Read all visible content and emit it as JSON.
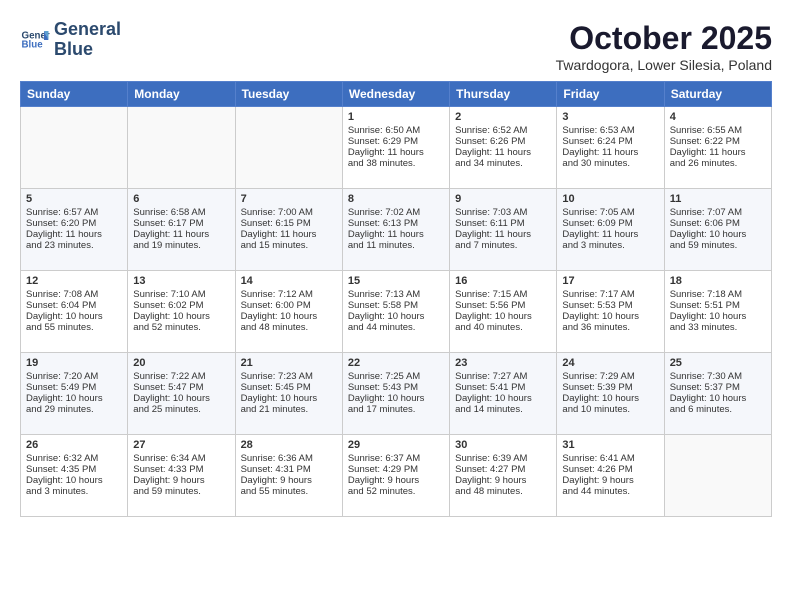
{
  "header": {
    "logo_line1": "General",
    "logo_line2": "Blue",
    "month": "October 2025",
    "location": "Twardogora, Lower Silesia, Poland"
  },
  "weekdays": [
    "Sunday",
    "Monday",
    "Tuesday",
    "Wednesday",
    "Thursday",
    "Friday",
    "Saturday"
  ],
  "weeks": [
    [
      {
        "day": "",
        "info": ""
      },
      {
        "day": "",
        "info": ""
      },
      {
        "day": "",
        "info": ""
      },
      {
        "day": "1",
        "info": "Sunrise: 6:50 AM\nSunset: 6:29 PM\nDaylight: 11 hours\nand 38 minutes."
      },
      {
        "day": "2",
        "info": "Sunrise: 6:52 AM\nSunset: 6:26 PM\nDaylight: 11 hours\nand 34 minutes."
      },
      {
        "day": "3",
        "info": "Sunrise: 6:53 AM\nSunset: 6:24 PM\nDaylight: 11 hours\nand 30 minutes."
      },
      {
        "day": "4",
        "info": "Sunrise: 6:55 AM\nSunset: 6:22 PM\nDaylight: 11 hours\nand 26 minutes."
      }
    ],
    [
      {
        "day": "5",
        "info": "Sunrise: 6:57 AM\nSunset: 6:20 PM\nDaylight: 11 hours\nand 23 minutes."
      },
      {
        "day": "6",
        "info": "Sunrise: 6:58 AM\nSunset: 6:17 PM\nDaylight: 11 hours\nand 19 minutes."
      },
      {
        "day": "7",
        "info": "Sunrise: 7:00 AM\nSunset: 6:15 PM\nDaylight: 11 hours\nand 15 minutes."
      },
      {
        "day": "8",
        "info": "Sunrise: 7:02 AM\nSunset: 6:13 PM\nDaylight: 11 hours\nand 11 minutes."
      },
      {
        "day": "9",
        "info": "Sunrise: 7:03 AM\nSunset: 6:11 PM\nDaylight: 11 hours\nand 7 minutes."
      },
      {
        "day": "10",
        "info": "Sunrise: 7:05 AM\nSunset: 6:09 PM\nDaylight: 11 hours\nand 3 minutes."
      },
      {
        "day": "11",
        "info": "Sunrise: 7:07 AM\nSunset: 6:06 PM\nDaylight: 10 hours\nand 59 minutes."
      }
    ],
    [
      {
        "day": "12",
        "info": "Sunrise: 7:08 AM\nSunset: 6:04 PM\nDaylight: 10 hours\nand 55 minutes."
      },
      {
        "day": "13",
        "info": "Sunrise: 7:10 AM\nSunset: 6:02 PM\nDaylight: 10 hours\nand 52 minutes."
      },
      {
        "day": "14",
        "info": "Sunrise: 7:12 AM\nSunset: 6:00 PM\nDaylight: 10 hours\nand 48 minutes."
      },
      {
        "day": "15",
        "info": "Sunrise: 7:13 AM\nSunset: 5:58 PM\nDaylight: 10 hours\nand 44 minutes."
      },
      {
        "day": "16",
        "info": "Sunrise: 7:15 AM\nSunset: 5:56 PM\nDaylight: 10 hours\nand 40 minutes."
      },
      {
        "day": "17",
        "info": "Sunrise: 7:17 AM\nSunset: 5:53 PM\nDaylight: 10 hours\nand 36 minutes."
      },
      {
        "day": "18",
        "info": "Sunrise: 7:18 AM\nSunset: 5:51 PM\nDaylight: 10 hours\nand 33 minutes."
      }
    ],
    [
      {
        "day": "19",
        "info": "Sunrise: 7:20 AM\nSunset: 5:49 PM\nDaylight: 10 hours\nand 29 minutes."
      },
      {
        "day": "20",
        "info": "Sunrise: 7:22 AM\nSunset: 5:47 PM\nDaylight: 10 hours\nand 25 minutes."
      },
      {
        "day": "21",
        "info": "Sunrise: 7:23 AM\nSunset: 5:45 PM\nDaylight: 10 hours\nand 21 minutes."
      },
      {
        "day": "22",
        "info": "Sunrise: 7:25 AM\nSunset: 5:43 PM\nDaylight: 10 hours\nand 17 minutes."
      },
      {
        "day": "23",
        "info": "Sunrise: 7:27 AM\nSunset: 5:41 PM\nDaylight: 10 hours\nand 14 minutes."
      },
      {
        "day": "24",
        "info": "Sunrise: 7:29 AM\nSunset: 5:39 PM\nDaylight: 10 hours\nand 10 minutes."
      },
      {
        "day": "25",
        "info": "Sunrise: 7:30 AM\nSunset: 5:37 PM\nDaylight: 10 hours\nand 6 minutes."
      }
    ],
    [
      {
        "day": "26",
        "info": "Sunrise: 6:32 AM\nSunset: 4:35 PM\nDaylight: 10 hours\nand 3 minutes."
      },
      {
        "day": "27",
        "info": "Sunrise: 6:34 AM\nSunset: 4:33 PM\nDaylight: 9 hours\nand 59 minutes."
      },
      {
        "day": "28",
        "info": "Sunrise: 6:36 AM\nSunset: 4:31 PM\nDaylight: 9 hours\nand 55 minutes."
      },
      {
        "day": "29",
        "info": "Sunrise: 6:37 AM\nSunset: 4:29 PM\nDaylight: 9 hours\nand 52 minutes."
      },
      {
        "day": "30",
        "info": "Sunrise: 6:39 AM\nSunset: 4:27 PM\nDaylight: 9 hours\nand 48 minutes."
      },
      {
        "day": "31",
        "info": "Sunrise: 6:41 AM\nSunset: 4:26 PM\nDaylight: 9 hours\nand 44 minutes."
      },
      {
        "day": "",
        "info": ""
      }
    ]
  ]
}
